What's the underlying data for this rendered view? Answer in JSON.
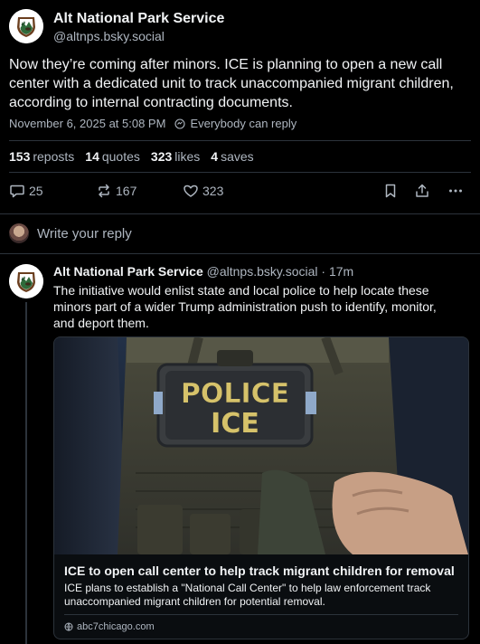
{
  "post": {
    "author_name": "Alt National Park Service",
    "author_handle": "@altnps.bsky.social",
    "text": "Now they’re coming after minors. ICE is planning to open a new call center with a dedicated unit to track unaccompanied migrant children, according to internal contracting documents.",
    "timestamp": "November 6, 2025 at 5:08 PM",
    "reply_setting": "Everybody can reply",
    "stats": {
      "reposts_count": "153",
      "reposts_label": "reposts",
      "quotes_count": "14",
      "quotes_label": "quotes",
      "likes_count": "323",
      "likes_label": "likes",
      "saves_count": "4",
      "saves_label": "saves"
    },
    "actions": {
      "reply_count": "25",
      "repost_count": "167",
      "like_count": "323"
    }
  },
  "composer": {
    "placeholder": "Write your reply"
  },
  "reply": {
    "author_name": "Alt National Park Service",
    "author_handle": "@altnps.bsky.social",
    "separator": "·",
    "time": "17m",
    "text": "The initiative would enlist state and local police to help locate these minors part of a wider Trump administration push to identify, monitor, and deport them.",
    "card": {
      "image_text_line1": "POLICE",
      "image_text_line2": "ICE",
      "title": "ICE to open call center to help track migrant children for removal",
      "description": "ICE plans to establish a \"National Call Center\" to help law enforcement track unaccompanied migrant children for potential removal.",
      "domain": "abc7chicago.com"
    }
  },
  "icons": {
    "reply": "speech-bubble-icon",
    "repost": "repost-arrows-icon",
    "like": "heart-icon",
    "bookmark": "bookmark-icon",
    "share": "share-icon",
    "more": "more-dots-icon",
    "globe": "globe-icon"
  },
  "colors": {
    "background": "#000000",
    "text": "#f1f3f5",
    "muted": "#aeb6c0",
    "border": "#2c333b"
  }
}
